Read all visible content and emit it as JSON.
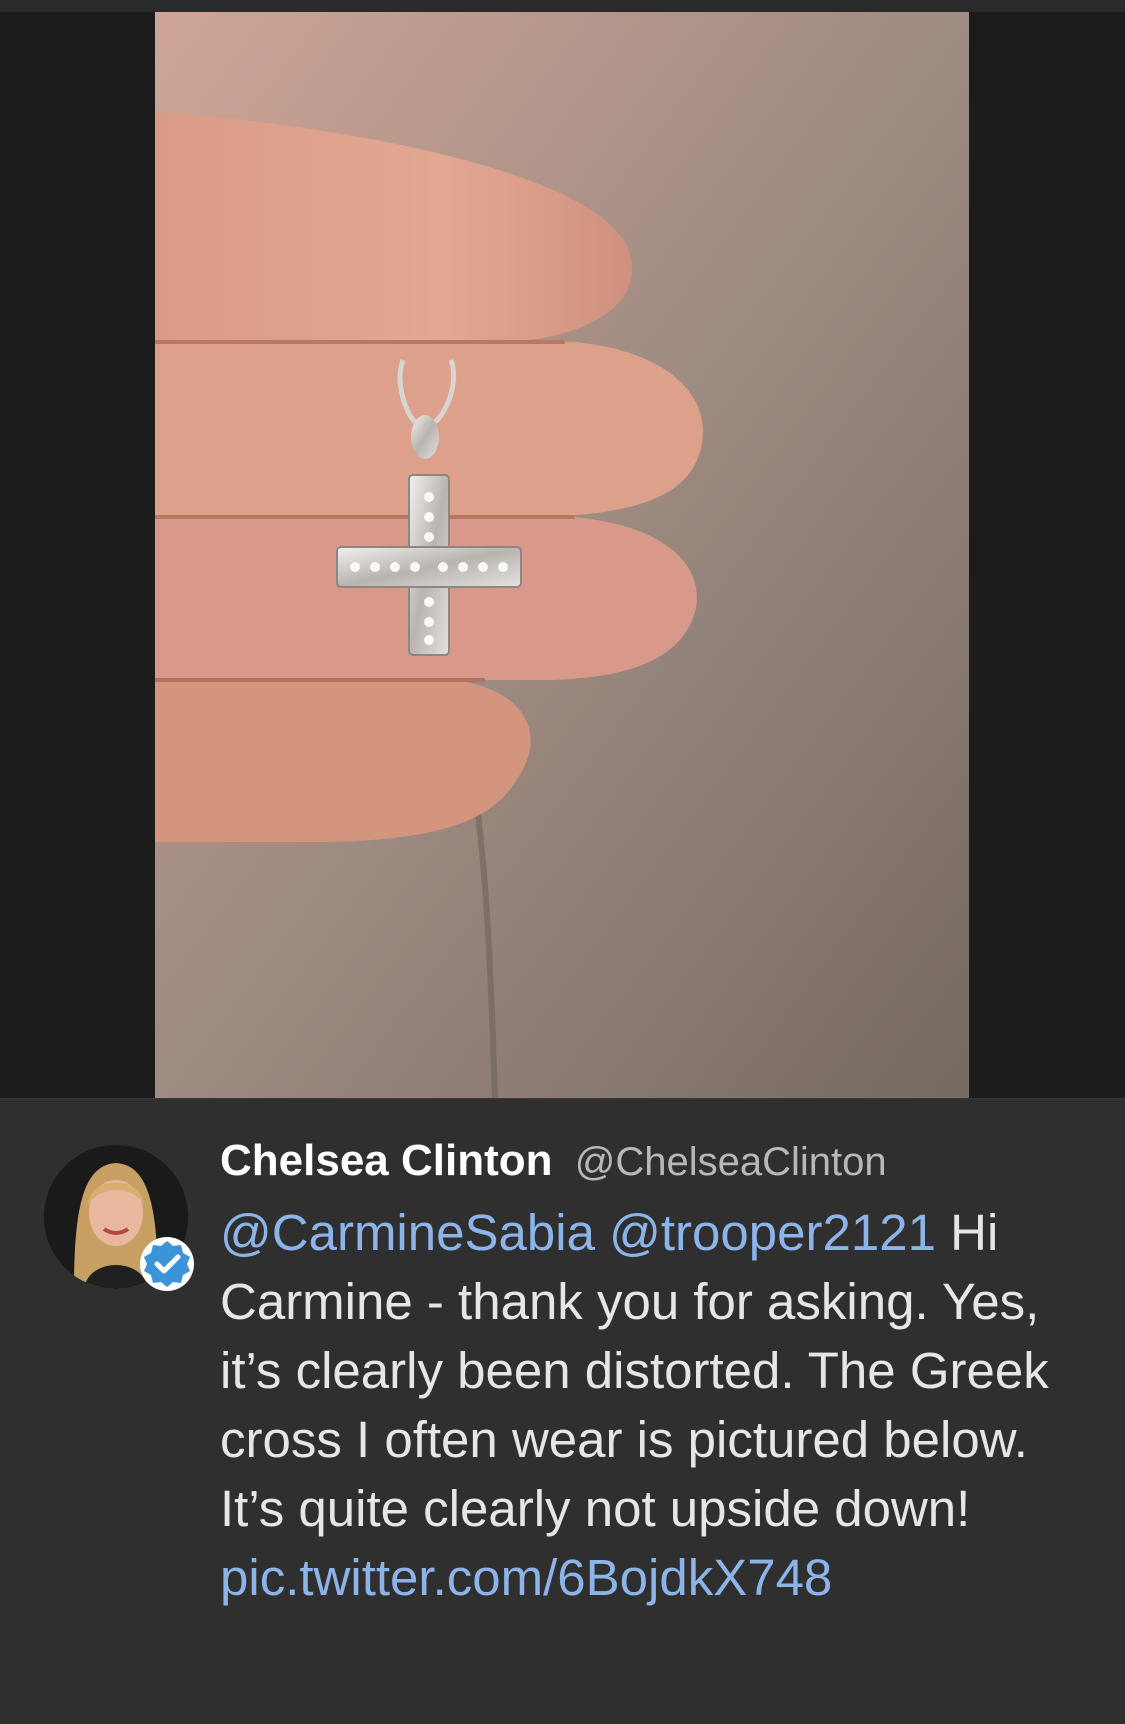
{
  "tweet": {
    "author": {
      "name": "Chelsea Clinton",
      "handle": "@ChelseaClinton",
      "verified": true
    },
    "mentions": [
      "@CarmineSabia",
      "@trooper2121"
    ],
    "text_before_link": "Hi Carmine - thank you for asking. Yes, it’s clearly been distorted. The Greek cross I often wear is pictured below. It’s quite clearly not upside down!",
    "link": "pic.twitter.com/6BojdkX748"
  },
  "colors": {
    "background": "#1c1c1c",
    "card": "#2f2f30",
    "text": "#e6e6e6",
    "link": "#8db4e8",
    "verified": "#3b94d9"
  },
  "media": {
    "description_icon": "photo-hand-holding-cross-pendant"
  }
}
